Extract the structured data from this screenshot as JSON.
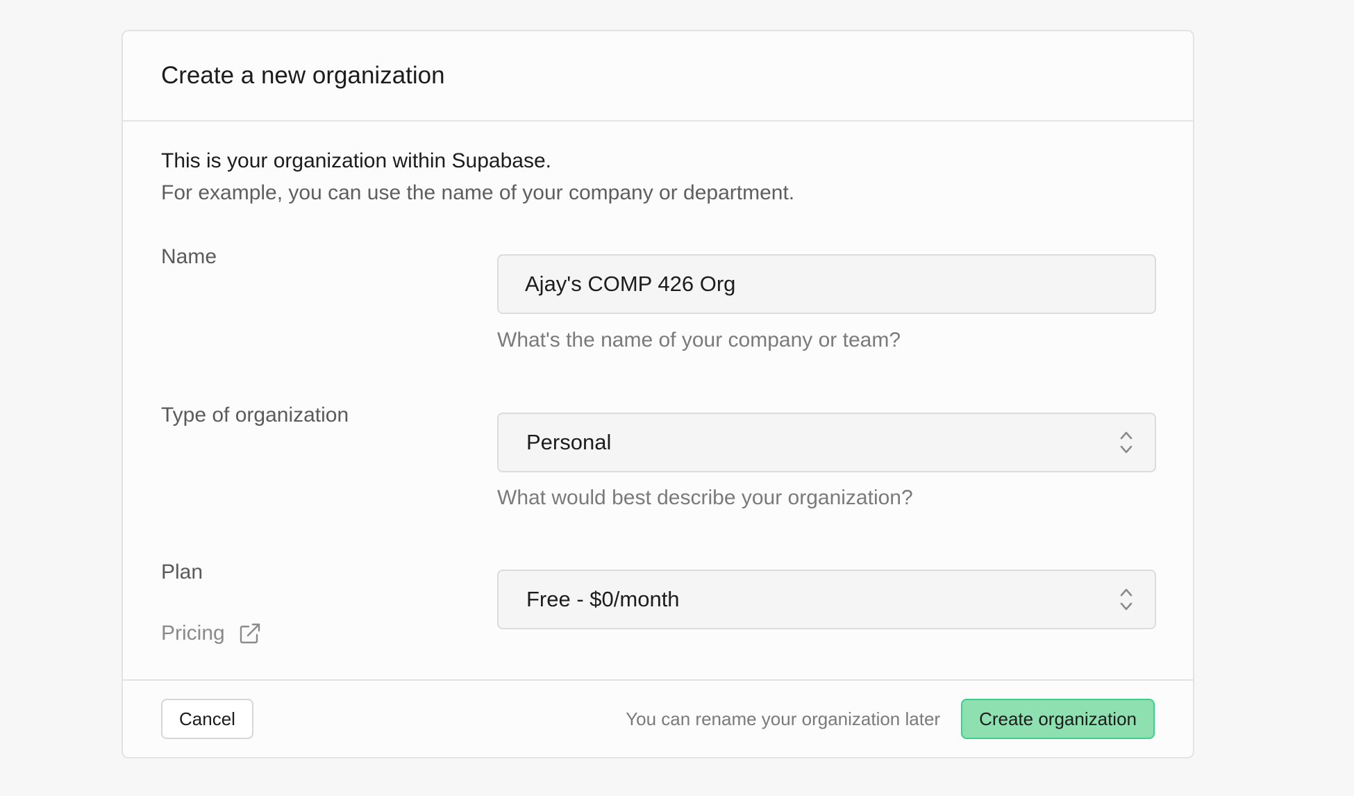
{
  "dialog": {
    "title": "Create a new organization",
    "intro_line_1": "This is your organization within Supabase.",
    "intro_line_2": "For example, you can use the name of your company or department."
  },
  "form": {
    "name": {
      "label": "Name",
      "value": "Ajay's COMP 426 Org",
      "help": "What's the name of your company or team?"
    },
    "type": {
      "label": "Type of organization",
      "selected": "Personal",
      "help": "What would best describe your organization?",
      "icon": "chevron-up-down-icon"
    },
    "plan": {
      "label": "Plan",
      "selected": "Free - $0/month",
      "pricing_link": "Pricing",
      "pricing_icon": "external-link-icon",
      "icon": "chevron-up-down-icon"
    }
  },
  "footer": {
    "cancel_label": "Cancel",
    "note": "You can rename your organization later",
    "create_label": "Create organization"
  },
  "colors": {
    "accent": "#3ecf8e",
    "primary_button_bg": "#8fe0b0"
  }
}
